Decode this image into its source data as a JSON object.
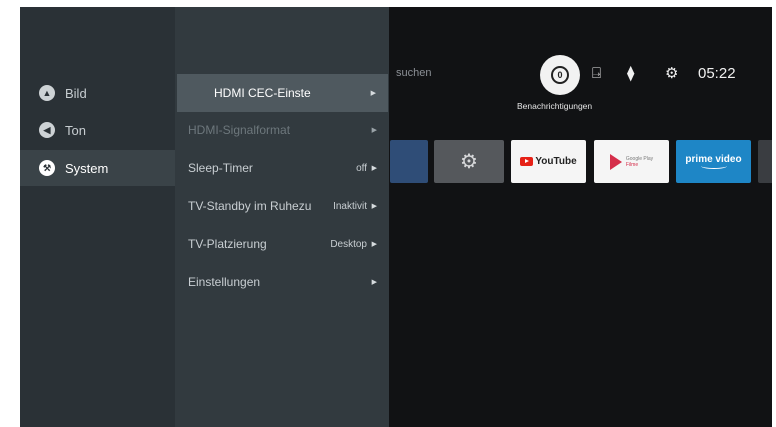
{
  "home": {
    "search_hint": "suchen",
    "notification_label": "Benachrichtigungen",
    "clock": "05:22",
    "apps": {
      "youtube": "YouTube",
      "google_play_top": "Google Play",
      "google_play_bottom": "Filme",
      "prime": "prime video"
    }
  },
  "sidebar": {
    "items": [
      {
        "label": "Bild",
        "icon": "picture-icon"
      },
      {
        "label": "Ton",
        "icon": "sound-icon"
      },
      {
        "label": "System",
        "icon": "wrench-icon",
        "selected": true
      }
    ]
  },
  "submenu": {
    "items": [
      {
        "label": "HDMI CEC-Einste",
        "value": "",
        "focused": true
      },
      {
        "label": "HDMI-Signalformat",
        "value": "",
        "disabled": true
      },
      {
        "label": "Sleep-Timer",
        "value": "off"
      },
      {
        "label": "TV-Standby im Ruhezu",
        "value": "Inaktivit"
      },
      {
        "label": "TV-Platzierung",
        "value": "Desktop"
      },
      {
        "label": "Einstellungen",
        "value": ""
      }
    ]
  },
  "colors": {
    "left_panel": "#2a3136",
    "sub_panel": "#323a3f",
    "focus": "#4f595f",
    "background": "#111214"
  }
}
